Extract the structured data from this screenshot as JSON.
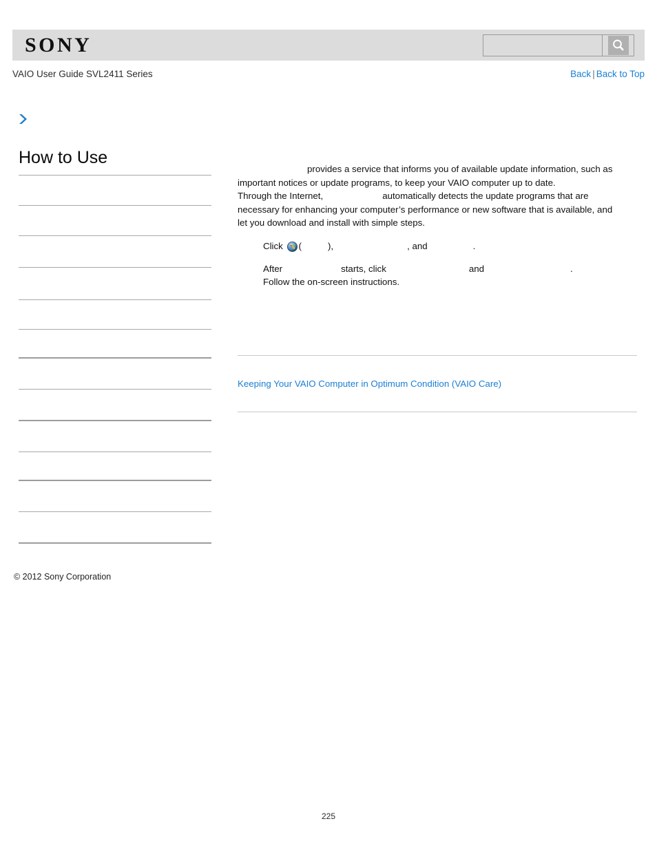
{
  "header": {
    "logo_text": "SONY",
    "search": {
      "value": "",
      "placeholder": "",
      "button_icon": "search-icon"
    }
  },
  "subhead": {
    "guide_title": "VAIO User Guide SVL2411 Series",
    "back_label": "Back",
    "separator": "|",
    "back_to_top_label": "Back to Top"
  },
  "sidebar": {
    "arrow_icon": "chevron-right-icon",
    "title": "How to Use",
    "items": [
      {
        "label": ""
      },
      {
        "label": ""
      },
      {
        "label": ""
      },
      {
        "label": ""
      },
      {
        "label": ""
      },
      {
        "label": ""
      },
      {
        "label": ""
      },
      {
        "label": ""
      },
      {
        "label": ""
      },
      {
        "label": ""
      },
      {
        "label": ""
      },
      {
        "label": ""
      },
      {
        "label": ""
      }
    ]
  },
  "main": {
    "paragraph": {
      "lead_product": "",
      "line1_tail": "provides a service that informs you of available update information, such as",
      "line2": "important notices or update programs, to keep your VAIO computer up to date.",
      "line3_head": "Through the Internet,",
      "line3_product": "",
      "line3_tail": "automatically detects the update programs that are",
      "line4": "necessary for enhancing your computer’s performance or new software that is available, and",
      "line5": "let you download and install with simple steps."
    },
    "steps": [
      {
        "click_label": "Click",
        "icon": "windows-start-orb-icon",
        "paren_open": "(",
        "paren_item": "",
        "paren_close": "),",
        "item2": "",
        "comma": ",",
        "and_label": "and",
        "item3": "",
        "period": "."
      },
      {
        "after_label": "After",
        "product": "",
        "starts_label": "starts, click",
        "item1": "",
        "and_label": "and",
        "item2": "",
        "period": "."
      },
      {
        "text": "Follow the on-screen instructions."
      }
    ],
    "related_link": "Keeping Your VAIO Computer in Optimum Condition (VAIO Care)"
  },
  "footer": {
    "copyright": "© 2012 Sony Corporation",
    "page_number": "225"
  },
  "colors": {
    "link_blue": "#1a7fd4",
    "header_gray": "#dcdcdc",
    "rule_gray": "#c9c9c9",
    "divider_gray": "#a8a8a8"
  }
}
